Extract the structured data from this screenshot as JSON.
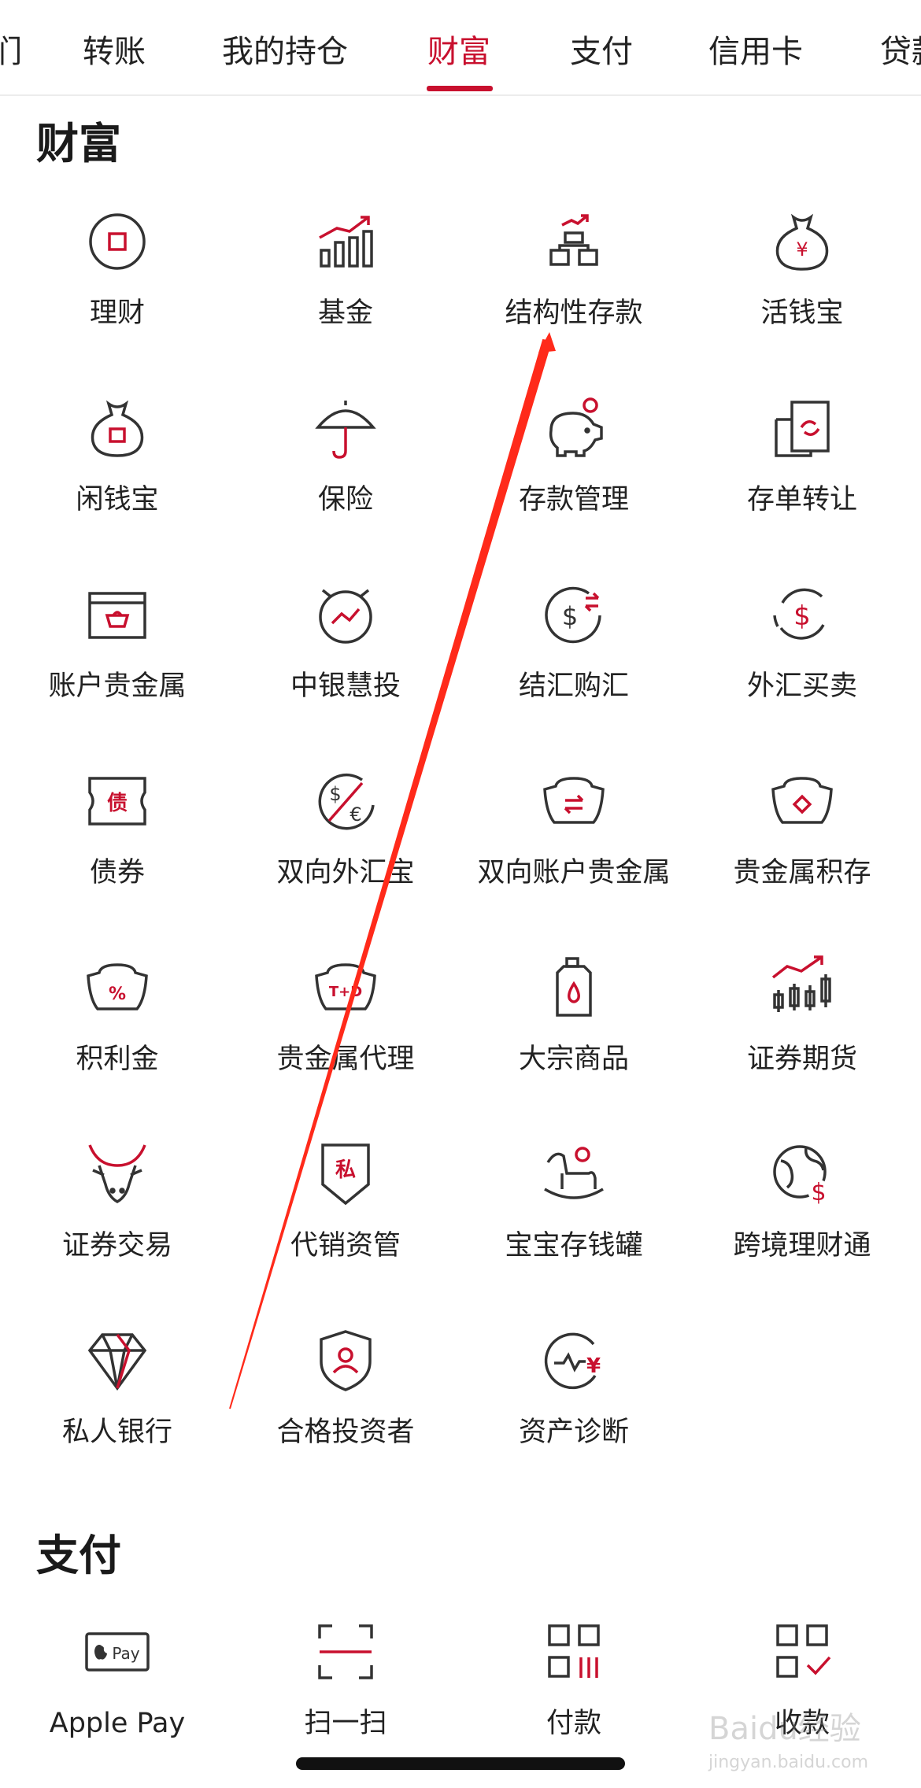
{
  "colors": {
    "accent": "#c8102e",
    "text": "#222222",
    "icon_stroke": "#333333",
    "annotation": "#ff2a1a"
  },
  "tabs": [
    {
      "label": "们",
      "active": false
    },
    {
      "label": "转账",
      "active": false
    },
    {
      "label": "我的持仓",
      "active": false
    },
    {
      "label": "财富",
      "active": true
    },
    {
      "label": "支付",
      "active": false
    },
    {
      "label": "信用卡",
      "active": false
    },
    {
      "label": "贷款",
      "active": false
    }
  ],
  "wealth": {
    "title": "财富",
    "items": [
      {
        "label": "理财",
        "icon": "wealth-coin-icon"
      },
      {
        "label": "基金",
        "icon": "fund-chart-icon"
      },
      {
        "label": "结构性存款",
        "icon": "structured-deposit-icon"
      },
      {
        "label": "活钱宝",
        "icon": "money-bag-yen-icon"
      },
      {
        "label": "闲钱宝",
        "icon": "money-bag-icon"
      },
      {
        "label": "保险",
        "icon": "umbrella-icon"
      },
      {
        "label": "存款管理",
        "icon": "piggy-bank-icon"
      },
      {
        "label": "存单转让",
        "icon": "certificate-transfer-icon"
      },
      {
        "label": "账户贵金属",
        "icon": "gold-box-icon"
      },
      {
        "label": "中银慧投",
        "icon": "alarm-chart-icon"
      },
      {
        "label": "结汇购汇",
        "icon": "dollar-exchange-icon"
      },
      {
        "label": "外汇买卖",
        "icon": "dollar-cycle-icon"
      },
      {
        "label": "债券",
        "icon": "bond-ticket-icon"
      },
      {
        "label": "双向外汇宝",
        "icon": "dollar-euro-icon"
      },
      {
        "label": "双向账户贵金属",
        "icon": "ingot-exchange-icon"
      },
      {
        "label": "贵金属积存",
        "icon": "ingot-icon"
      },
      {
        "label": "积利金",
        "icon": "ingot-percent-icon"
      },
      {
        "label": "贵金属代理",
        "icon": "ingot-td-icon"
      },
      {
        "label": "大宗商品",
        "icon": "oil-can-icon"
      },
      {
        "label": "证券期货",
        "icon": "candlestick-icon"
      },
      {
        "label": "证券交易",
        "icon": "bull-icon"
      },
      {
        "label": "代销资管",
        "icon": "private-badge-icon"
      },
      {
        "label": "宝宝存钱罐",
        "icon": "rocking-horse-icon"
      },
      {
        "label": "跨境理财通",
        "icon": "globe-dollar-icon"
      },
      {
        "label": "私人银行",
        "icon": "diamond-icon"
      },
      {
        "label": "合格投资者",
        "icon": "shield-user-icon"
      },
      {
        "label": "资产诊断",
        "icon": "asset-diagnosis-icon"
      }
    ],
    "glyphs": {
      "yen": "¥",
      "dollar": "$",
      "euro": "€",
      "bond": "债",
      "percent": "%",
      "td": "T+D",
      "private": "私"
    }
  },
  "payment": {
    "title": "支付",
    "items": [
      {
        "label": "Apple Pay",
        "icon": "apple-pay-icon",
        "icon_text": "Pay"
      },
      {
        "label": "扫一扫",
        "icon": "scan-icon"
      },
      {
        "label": "付款",
        "icon": "payment-code-icon"
      },
      {
        "label": "收款",
        "icon": "receive-code-icon"
      }
    ]
  },
  "watermark": {
    "text": "Baidu经验",
    "subtext": "jingyan.baidu.com"
  }
}
